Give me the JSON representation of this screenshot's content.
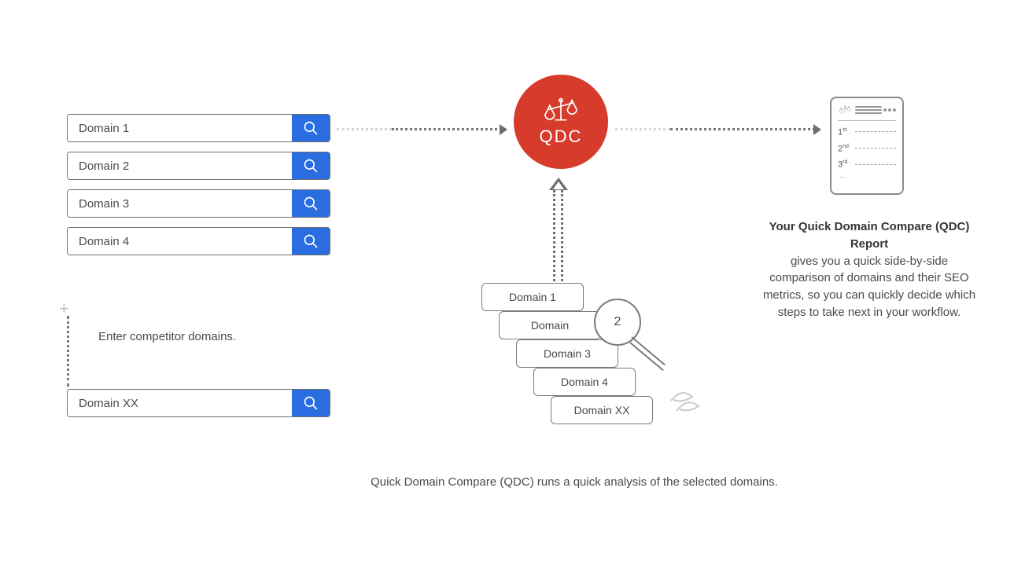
{
  "inputs": {
    "rows": [
      {
        "label": "Domain 1"
      },
      {
        "label": "Domain 2"
      },
      {
        "label": "Domain 3"
      },
      {
        "label": "Domain 4"
      }
    ],
    "last": {
      "label": "Domain XX"
    },
    "hint": "Enter competitor domains."
  },
  "qdc": {
    "label": "QDC"
  },
  "stack": {
    "cards": [
      {
        "label": "Domain 1"
      },
      {
        "label": "Domain"
      },
      {
        "label": "Domain 3"
      },
      {
        "label": "Domain 4"
      },
      {
        "label": "Domain XX"
      }
    ],
    "magnified": "2",
    "caption": "Quick Domain Compare (QDC) runs a quick analysis of the selected domains."
  },
  "report": {
    "ranks": [
      "1",
      "2",
      "3"
    ],
    "suffixes": [
      "st",
      "nd",
      "rd"
    ],
    "ellipsis": "...",
    "title": "Your Quick Domain Compare (QDC) Report",
    "body": "gives you a quick side-by-side comparison of domains and their SEO metrics, so you can quickly decide which steps to take next in your workflow."
  }
}
